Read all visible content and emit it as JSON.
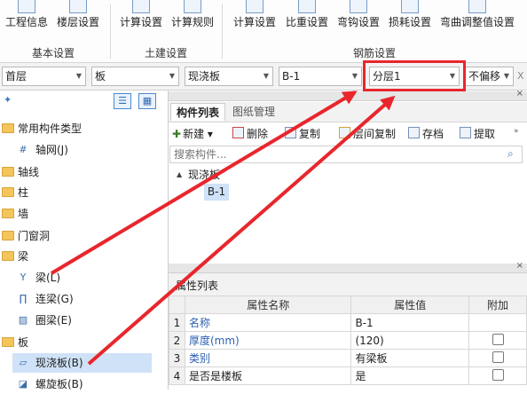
{
  "ribbon": {
    "buttons": [
      {
        "label": "工程信息"
      },
      {
        "label": "楼层设置"
      },
      {
        "label": "计算设置"
      },
      {
        "label": "计算规则"
      },
      {
        "label": "计算设置"
      },
      {
        "label": "比重设置"
      },
      {
        "label": "弯钩设置"
      },
      {
        "label": "损耗设置"
      },
      {
        "label": "弯曲调整值设置"
      }
    ],
    "groups": [
      "基本设置",
      "土建设置",
      "钢筋设置"
    ]
  },
  "selectors": {
    "floor": "首层",
    "component_type": "板",
    "category": "现浇板",
    "component": "B-1",
    "layer": "分层1",
    "offset": "不偏移",
    "close": "X"
  },
  "tree": {
    "items": [
      {
        "label": "常用构件类型",
        "kind": "folder"
      },
      {
        "label": "轴网(J)",
        "kind": "item",
        "icon": "axis-grid-icon"
      },
      {
        "label": "轴线",
        "kind": "folder"
      },
      {
        "label": "柱",
        "kind": "folder"
      },
      {
        "label": "墙",
        "kind": "folder"
      },
      {
        "label": "门窗洞",
        "kind": "folder"
      },
      {
        "label": "梁",
        "kind": "folder"
      },
      {
        "label": "梁(L)",
        "kind": "item",
        "icon": "beam-icon"
      },
      {
        "label": "连梁(G)",
        "kind": "item",
        "icon": "link-beam-icon"
      },
      {
        "label": "圈梁(E)",
        "kind": "item",
        "icon": "ring-beam-icon"
      },
      {
        "label": "板",
        "kind": "folder"
      },
      {
        "label": "现浇板(B)",
        "kind": "item",
        "icon": "slab-icon",
        "selected": true
      },
      {
        "label": "螺旋板(B)",
        "kind": "item",
        "icon": "spiral-slab-icon"
      }
    ]
  },
  "component_panel": {
    "tabs": [
      "构件列表",
      "图纸管理"
    ],
    "toolbar": [
      "新建",
      "删除",
      "复制",
      "层间复制",
      "存档",
      "提取"
    ],
    "new_dropdown": "▾",
    "search_placeholder": "搜索构件...",
    "tree_root": "现浇板",
    "tree_child": "B-1"
  },
  "props_panel": {
    "title": "属性列表",
    "columns": [
      "属性名称",
      "属性值",
      "附加"
    ],
    "rows": [
      {
        "no": "1",
        "name": "名称",
        "value": "B-1",
        "blue": true,
        "check": false
      },
      {
        "no": "2",
        "name": "厚度(mm)",
        "value": "(120)",
        "blue": true,
        "check": true
      },
      {
        "no": "3",
        "name": "类别",
        "value": "有梁板",
        "blue": true,
        "check": true
      },
      {
        "no": "4",
        "name": "是否是楼板",
        "value": "是",
        "blue": false,
        "check": true
      }
    ]
  },
  "colors": {
    "annotation_red": "#e8262c",
    "accent_blue": "#2c5fb3"
  }
}
